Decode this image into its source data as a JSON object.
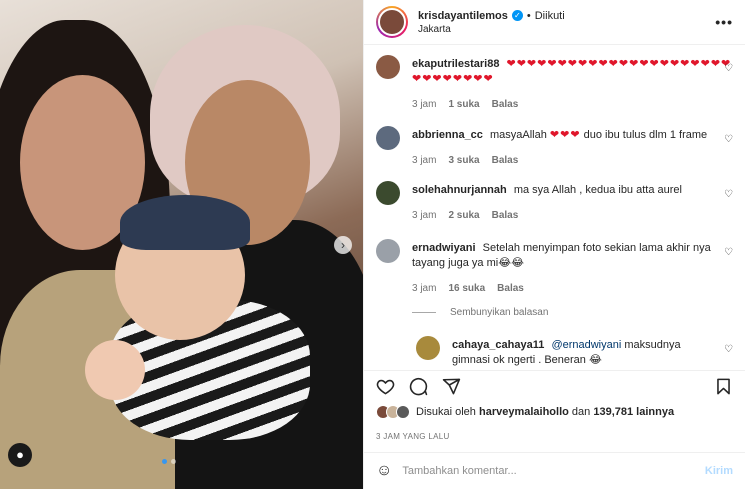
{
  "header": {
    "username": "krisdayantilemos",
    "follow_dot": "•",
    "follow_label": "Diikuti",
    "location": "Jakarta",
    "more_label": "•••"
  },
  "comments": [
    {
      "username": "ekaputrilestari88",
      "text": "",
      "hearts": "❤❤❤❤❤❤❤❤❤❤❤❤❤❤❤❤❤❤❤❤❤❤❤❤❤❤❤❤❤❤",
      "time": "3 jam",
      "likes": "1 suka",
      "reply": "Balas",
      "avatar_color": "#8a5a44"
    },
    {
      "username": "abbrienna_cc",
      "text_before": "masyaAllah",
      "hearts": "❤❤❤",
      "text_after": "duo ibu tulus dlm 1 frame",
      "time": "3 jam",
      "likes": "3 suka",
      "reply": "Balas",
      "avatar_color": "#5d6a7e"
    },
    {
      "username": "solehahnurjannah",
      "text": "ma sya Allah , kedua ibu atta aurel",
      "time": "3 jam",
      "likes": "2 suka",
      "reply": "Balas",
      "avatar_color": "#3b4a2e"
    },
    {
      "username": "ernadwiyani",
      "text": "Setelah menyimpan foto sekian lama akhir nya tayang juga ya mi😂😂",
      "time": "3 jam",
      "likes": "16 suka",
      "reply": "Balas",
      "avatar_color": "#9aa0a8"
    },
    {
      "username": "cahaya_cahaya11",
      "mention": "@ernadwiyani",
      "text": "maksudnya gimnasi ok ngerti . Beneran 😂",
      "avatar_color": "#a88a3c"
    }
  ],
  "hide_replies": "Sembunyikan balasan",
  "likes": {
    "prefix": "Disukai oleh",
    "user": "harveymalaihollo",
    "conj": "dan",
    "count": "139,781 lainnya"
  },
  "timeago": "3 JAM YANG LALU",
  "comment_input": {
    "placeholder": "Tambahkan komentar..."
  },
  "send_label": "Kirim",
  "icons": {
    "heart": "heart-icon",
    "comment": "comment-icon",
    "share": "share-icon",
    "save": "bookmark-icon",
    "emoji": "emoji-icon"
  },
  "colors": {
    "accent": "#0095f6",
    "heart": "#e0162b",
    "muted": "#737373",
    "carousel_active": "#3797f0"
  }
}
